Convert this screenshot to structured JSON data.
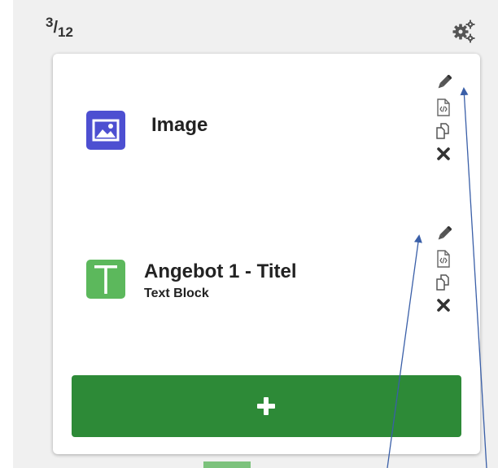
{
  "column": {
    "size_numerator": "3",
    "size_denominator": "12",
    "settings_icon": "gears-icon"
  },
  "blocks": [
    {
      "title": "Image",
      "subtitle": "",
      "icon": "image-icon",
      "icon_color": "#4d4fd1",
      "actions": [
        "edit-icon",
        "code-file-icon",
        "copy-icon",
        "delete-icon"
      ]
    },
    {
      "title": "Angebot 1 - Titel",
      "subtitle": "Text Block",
      "icon": "text-icon",
      "icon_color": "#5cb85c",
      "actions": [
        "edit-icon",
        "code-file-icon",
        "copy-icon",
        "delete-icon"
      ]
    }
  ],
  "add_button": {
    "icon": "plus-icon",
    "color": "#2d8a37"
  },
  "annotation": {
    "arrow_color": "#3a5fa8"
  }
}
